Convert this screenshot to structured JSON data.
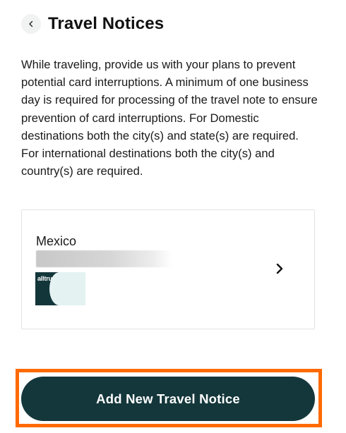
{
  "header": {
    "title": "Travel Notices",
    "back_icon": "chevron-left-icon"
  },
  "description": "While traveling, provide us with your plans to prevent potential card interruptions. A minimum of one business day is required for processing of the travel note to ensure prevention of card interruptions. For Domestic destinations both the city(s) and state(s) are required. For international destinations both the city(s) and country(s) are required.",
  "notice": {
    "destination": "Mexico",
    "card_brand": "alltru.",
    "chevron_icon": "chevron-right-icon"
  },
  "cta": {
    "label": "Add New Travel Notice",
    "highlight_color": "#ff6a00",
    "button_color": "#14373b"
  }
}
